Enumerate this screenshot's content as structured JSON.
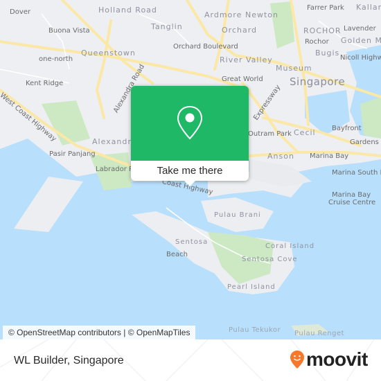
{
  "map": {
    "labels": {
      "dover": "Dover",
      "holland_road": "Holland Road",
      "ardmore": "Ardmore",
      "newton": "Newton",
      "farrer_park": "Farrer Park",
      "kallang": "Kallang",
      "buona_vista": "Buona Vista",
      "tanglin": "Tanglin",
      "orchard": "Orchard",
      "rochor_area": "ROCHOR",
      "lavender": "Lavender",
      "rochor": "Rochor",
      "golden_mile": "Golden Mile",
      "queenstown": "Queenstown",
      "orchard_boulevard": "Orchard Boulevard",
      "bugis": "Bugis",
      "one_north": "one-north",
      "river_valley": "River Valley",
      "nicoll_highway": "Nicoll Highway",
      "museum": "Museum",
      "kent_ridge": "Kent Ridge",
      "alexandra_road": "Alexandra Road",
      "great_world": "Great World",
      "singapore": "Singapore",
      "expressway": "Expressway",
      "west_coast_highway": "West Coast Highway",
      "outram_park": "Outram Park",
      "cecil": "Cecil",
      "bayfront": "Bayfront",
      "alexandra": "Alexandra",
      "gardens_by": "Gardens by",
      "pasir_panjang": "Pasir Panjang",
      "anson": "Anson",
      "marina_bay": "Marina Bay",
      "labrador_park": "Labrador Park",
      "coast_highway": "Coast Highway",
      "marina_south_pier": "Marina South Pier",
      "marina_bay_cruise_1": "Marina Bay",
      "marina_bay_cruise_2": "Cruise Centre",
      "pulau_brani": "Pulau Brani",
      "coral_island": "Coral Island",
      "sentosa": "Sentosa",
      "beach": "Beach",
      "sentosa_cove": "Sentosa Cove",
      "pearl_island": "Pearl Island",
      "pulau_tekukor": "Pulau Tekukor",
      "pulau_renget": "Pulau Renget"
    },
    "colors": {
      "land": "#eeeff2",
      "water": "#b8dffc",
      "park": "#cde9c3",
      "road": "#fbe8a6"
    }
  },
  "popup": {
    "icon": "map-pin-icon",
    "cta_label": "Take me there",
    "accent": "#1fb866"
  },
  "attribution": "© OpenStreetMap contributors | © OpenMapTiles",
  "footer": {
    "place": "WL Builder, Singapore",
    "brand": "moovit",
    "brand_color": "#f7772b"
  }
}
